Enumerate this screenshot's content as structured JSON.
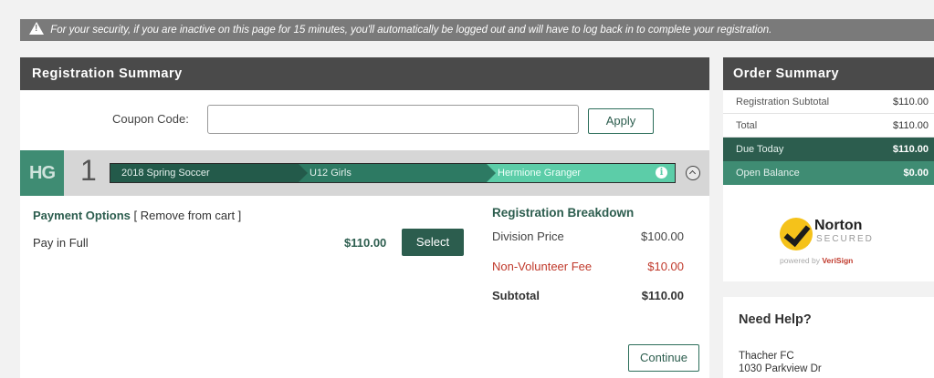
{
  "alert": {
    "icon": "warning-icon",
    "text": "For your security, if you are inactive on this page for 15 minutes, you'll automatically be logged out and will have to log back in to complete your registration."
  },
  "registration_summary": {
    "title": "Registration Summary",
    "coupon": {
      "label": "Coupon Code:",
      "value": "",
      "placeholder": "",
      "apply_label": "Apply"
    },
    "registrant": {
      "initials": "HG",
      "number": "1",
      "steps": [
        "2018 Spring Soccer",
        "U12 Girls",
        "Hermione Granger"
      ]
    },
    "payment_options": {
      "title": "Payment Options",
      "remove_label": "[ Remove from cart ]",
      "option_label": "Pay in Full",
      "option_amount": "$110.00",
      "select_label": "Select"
    },
    "breakdown": {
      "title": "Registration Breakdown",
      "rows": [
        {
          "label": "Division Price",
          "amount": "$100.00"
        },
        {
          "label": "Non-Volunteer Fee",
          "amount": "$10.00"
        },
        {
          "label": "Subtotal",
          "amount": "$110.00"
        }
      ]
    },
    "continue_label": "Continue"
  },
  "order_summary": {
    "title": "Order Summary",
    "rows": [
      {
        "label": "Registration Subtotal",
        "amount": "$110.00"
      },
      {
        "label": "Total",
        "amount": "$110.00"
      },
      {
        "label": "Due Today",
        "amount": "$110.00"
      },
      {
        "label": "Open Balance",
        "amount": "$0.00"
      }
    ],
    "badge": {
      "name": "Norton",
      "secured": "SECURED",
      "powered_prefix": "powered by",
      "powered_brand": "VeriSign"
    }
  },
  "help": {
    "title": "Need Help?",
    "lines": [
      "Thacher FC",
      "1030 Parkview Dr"
    ]
  },
  "colors": {
    "brand_dark": "#2c5d4e",
    "brand_mid": "#3f8c73",
    "brand_light": "#5ccda8",
    "fee_red": "#c0392b"
  }
}
